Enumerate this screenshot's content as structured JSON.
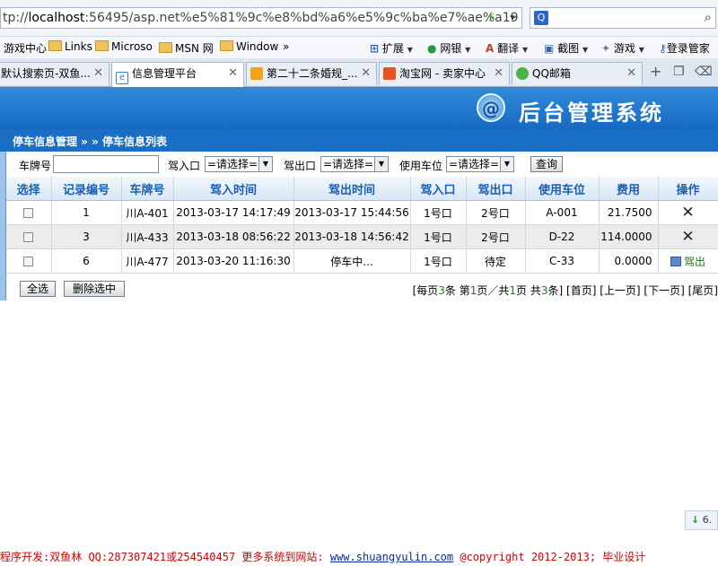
{
  "browser": {
    "url_prefix": "tp://",
    "url_host": "localhost",
    "url_rest": ":56495/asp.net%e5%81%9c%e8%bd%a6%e5%9c%ba%e7%ae%a19",
    "favorites": [
      {
        "label": "游戏中心"
      },
      {
        "label": "Links"
      },
      {
        "label": "Microso"
      },
      {
        "label": "MSN 网"
      },
      {
        "label": "Window"
      }
    ],
    "more": "»",
    "toolbar": [
      {
        "label": "扩展"
      },
      {
        "label": "网银"
      },
      {
        "label": "翻译"
      },
      {
        "label": "截图"
      },
      {
        "label": "游戏"
      },
      {
        "label": "登录管家"
      }
    ],
    "tabs": [
      {
        "label": "默认搜索页-双鱼..."
      },
      {
        "label": "信息管理平台"
      },
      {
        "label": "第二十二条婚规_..."
      },
      {
        "label": "淘宝网 - 卖家中心"
      },
      {
        "label": "QQ邮箱"
      }
    ]
  },
  "header": {
    "logo_mark": "@",
    "system_title": "后台管理系统",
    "breadcrumb": "停车信息管理 » » 停车信息列表"
  },
  "filter": {
    "plate_label": "车牌号",
    "plate_value": "",
    "entry_label": "驾入口",
    "entry_value": "=请选择=",
    "exit_label": "驾出口",
    "exit_value": "=请选择=",
    "space_label": "使用车位",
    "space_value": "=请选择=",
    "query_label": "查询"
  },
  "table": {
    "columns": [
      "选择",
      "记录编号",
      "车牌号",
      "驾入时间",
      "驾出时间",
      "驾入口",
      "驾出口",
      "使用车位",
      "费用",
      "操作"
    ],
    "rows": [
      {
        "id": "1",
        "plate": "川A-401",
        "in_time": "2013-03-17 14:17:49",
        "out_time": "2013-03-17 15:44:56",
        "entry": "1号口",
        "exit": "2号口",
        "space": "A-001",
        "fee": "21.7500",
        "action": "✕"
      },
      {
        "id": "3",
        "plate": "川A-433",
        "in_time": "2013-03-18 08:56:22",
        "out_time": "2013-03-18 14:56:42",
        "entry": "1号口",
        "exit": "2号口",
        "space": "D-22",
        "fee": "114.0000",
        "action": "✕"
      },
      {
        "id": "6",
        "plate": "川A-477",
        "in_time": "2013-03-20 11:16:30",
        "out_time": "停车中...",
        "entry": "1号口",
        "exit": "待定",
        "space": "C-33",
        "fee": "0.0000",
        "action": "驾出"
      }
    ]
  },
  "actions": {
    "select_all": "全选",
    "delete_selected": "删除选中"
  },
  "pager": {
    "per_page_pre": "[每页",
    "per_page": "3",
    "per_page_post": "条 第",
    "current": "1",
    "of_pre": "页／共",
    "total_pages": "1",
    "total_pre": "页 共",
    "total": "3",
    "total_post": "条]",
    "first": "[首页]",
    "prev": "[上一页]",
    "next": "[下一页]",
    "last": "[尾页]"
  },
  "float_button": "6.",
  "footer": {
    "text_pre": "程序开发:双鱼林  QQ:287307421或254540457  更多系统到网站: ",
    "site": "www.shuangyulin.com",
    "text_post": " @copyright 2012-2013; 毕业设计"
  }
}
